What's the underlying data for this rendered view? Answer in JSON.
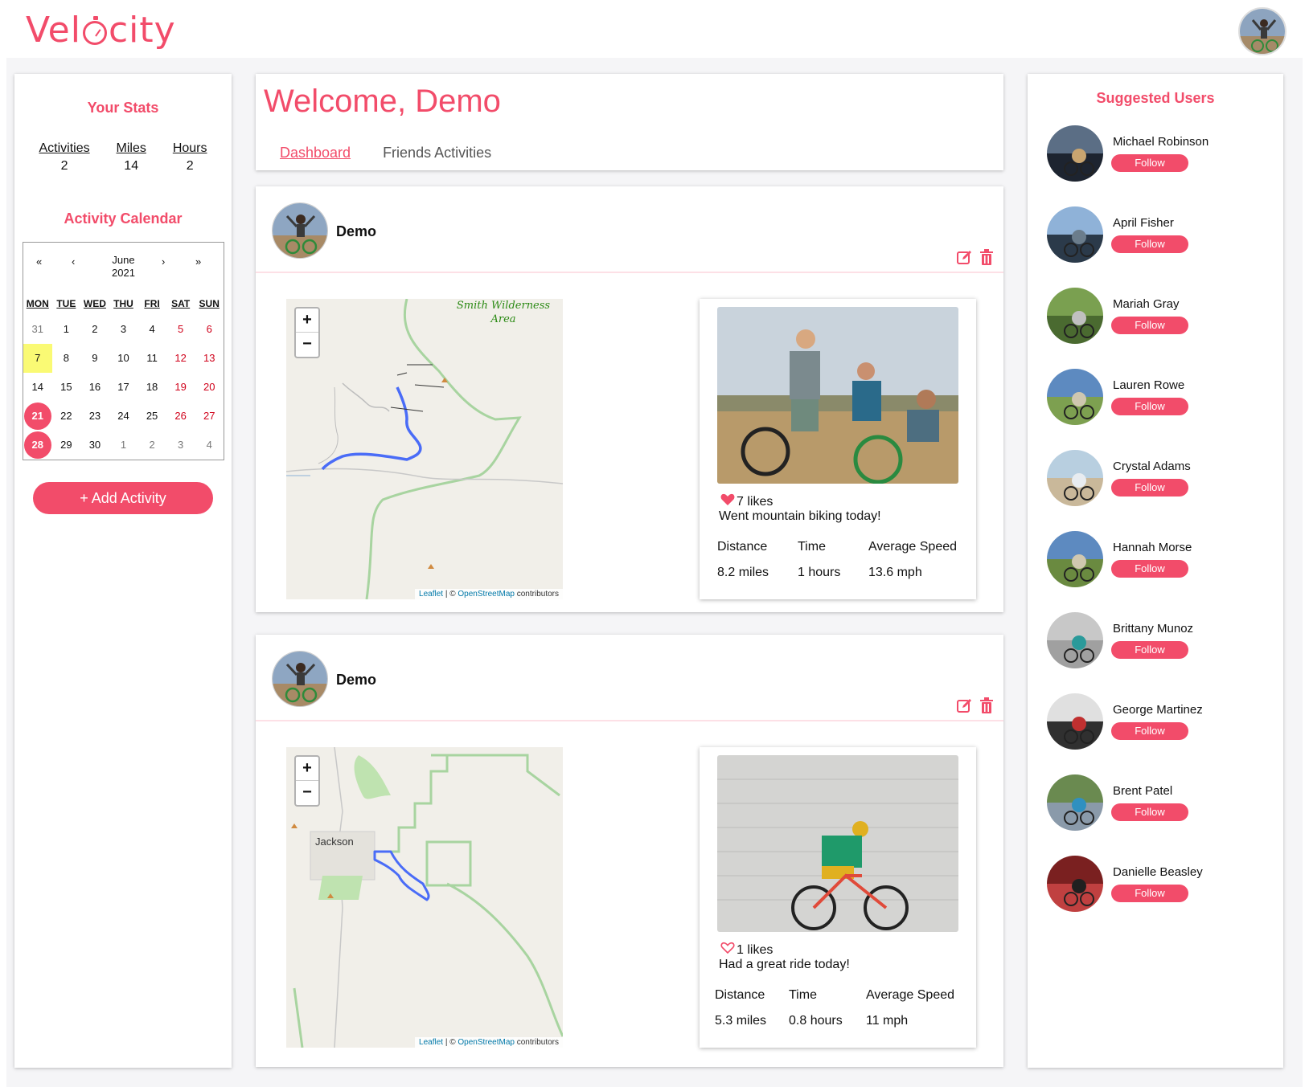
{
  "app": {
    "logo_text_a": "Vel",
    "logo_text_b": "city"
  },
  "stats": {
    "title": "Your Stats",
    "items": [
      {
        "label": "Activities",
        "value": "2"
      },
      {
        "label": "Miles",
        "value": "14"
      },
      {
        "label": "Hours",
        "value": "2"
      }
    ]
  },
  "calendar": {
    "title": "Activity Calendar",
    "nav": {
      "prev_year": "«",
      "prev_month": "‹",
      "next_month": "›",
      "next_year": "»"
    },
    "month": "June",
    "year": "2021",
    "weekdays": [
      "MON",
      "TUE",
      "WED",
      "THU",
      "FRI",
      "SAT",
      "SUN"
    ],
    "rows": [
      [
        "31",
        "1",
        "2",
        "3",
        "4",
        "5",
        "6"
      ],
      [
        "7",
        "8",
        "9",
        "10",
        "11",
        "12",
        "13"
      ],
      [
        "14",
        "15",
        "16",
        "17",
        "18",
        "19",
        "20"
      ],
      [
        "21",
        "22",
        "23",
        "24",
        "25",
        "26",
        "27"
      ],
      [
        "28",
        "29",
        "30",
        "1",
        "2",
        "3",
        "4"
      ]
    ]
  },
  "add_activity": "+ Add Activity",
  "welcome": {
    "title": "Welcome, Demo",
    "tabs": {
      "dashboard": "Dashboard",
      "friends": "Friends Activities"
    }
  },
  "activities": [
    {
      "user": "Demo",
      "map_label_1": "Smith Wilderness",
      "map_label_2": "Area",
      "likes": "7 likes",
      "liked": true,
      "caption": "Went mountain biking today!",
      "metric_labels": [
        "Distance",
        "Time",
        "Average Speed"
      ],
      "metric_values": [
        "8.2 miles",
        "1 hours",
        "13.6 mph"
      ]
    },
    {
      "user": "Demo",
      "town": "Jackson",
      "likes": "1 likes",
      "liked": false,
      "caption": "Had a great ride today!",
      "metric_labels": [
        "Distance",
        "Time",
        "Average Speed"
      ],
      "metric_values": [
        "5.3 miles",
        "0.8 hours",
        "11 mph"
      ]
    }
  ],
  "map_attribution": {
    "leaflet": "Leaflet",
    "sep": " | © ",
    "osm": "OpenStreetMap",
    "suffix": " contributors"
  },
  "map_zoom": {
    "in": "+",
    "out": "−"
  },
  "suggested": {
    "title": "Suggested Users",
    "follow_label": "Follow",
    "users": [
      "Michael Robinson",
      "April Fisher",
      "Mariah Gray",
      "Lauren Rowe",
      "Crystal Adams",
      "Hannah Morse",
      "Brittany Munoz",
      "George Martinez",
      "Brent Patel",
      "Danielle Beasley"
    ]
  },
  "colors": {
    "accent": "#f24c6a",
    "route": "#4a6cf7",
    "weekend": "#d0021b",
    "today": "#fafa74"
  }
}
